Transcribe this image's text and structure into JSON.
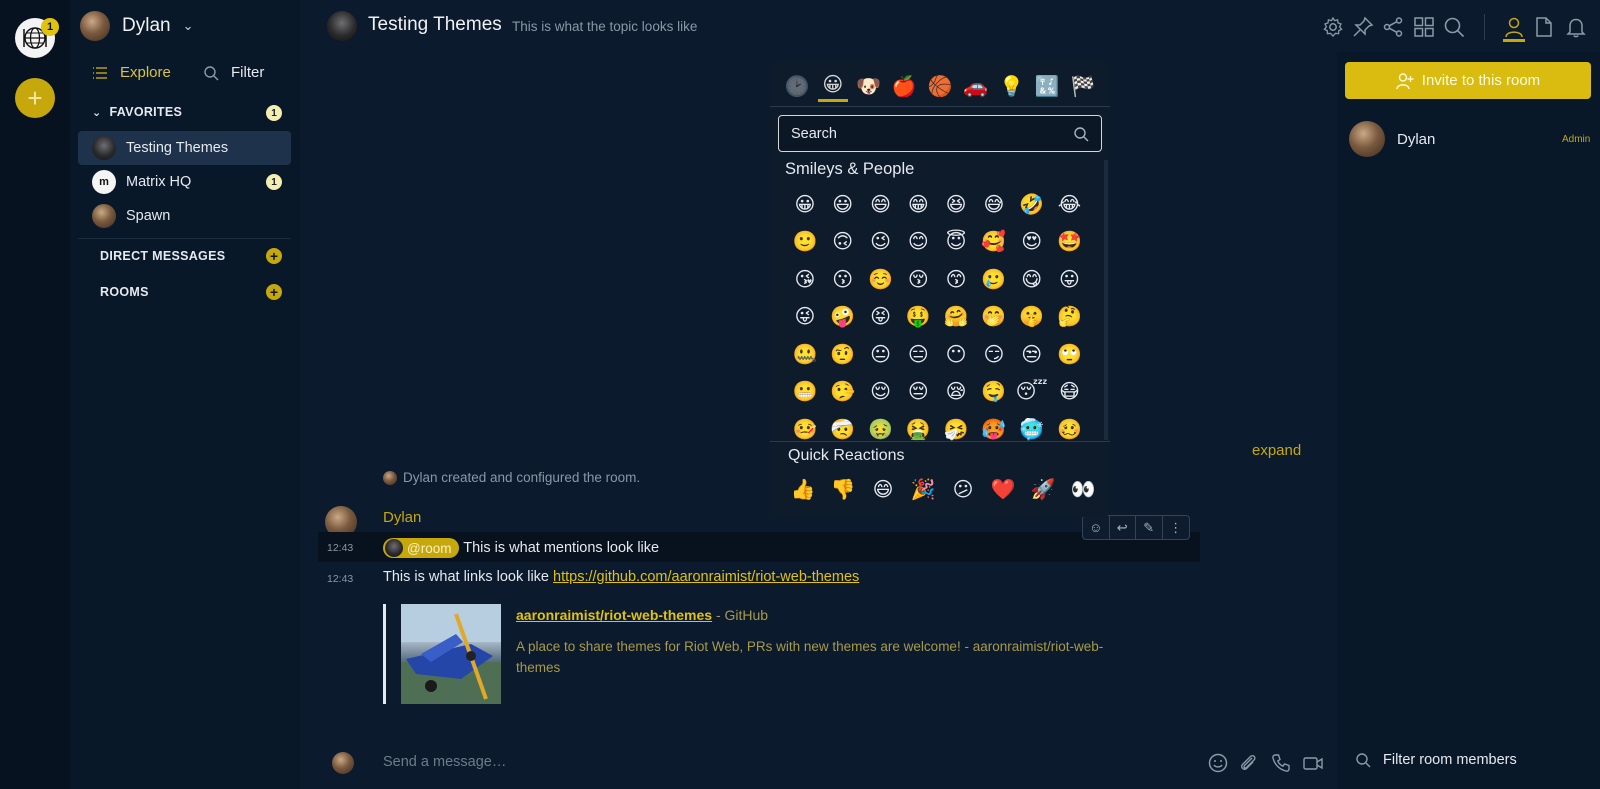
{
  "space_bar": {
    "home_badge": "1",
    "add_space_symbol": "+"
  },
  "room_list": {
    "user_name": "Dylan",
    "explore_label": "Explore",
    "filter_label": "Filter",
    "sections": {
      "favourites": {
        "label": "FAVORITES",
        "badge": "1"
      },
      "direct_messages": {
        "label": "DIRECT MESSAGES"
      },
      "rooms": {
        "label": "ROOMS"
      }
    },
    "rooms": [
      {
        "name": "Testing Themes",
        "badge": ""
      },
      {
        "name": "Matrix HQ",
        "badge": "1",
        "avatar_letter": "m"
      },
      {
        "name": "Spawn",
        "badge": ""
      }
    ]
  },
  "header": {
    "room_name": "Testing Themes",
    "topic": "This is what the topic looks like",
    "icons": [
      "settings-icon",
      "pin-icon",
      "share-icon",
      "apps-grid-icon",
      "search-icon",
      "people-icon",
      "files-icon",
      "notifications-icon"
    ]
  },
  "timeline": {
    "created_notice": "Dylan created and configured the room.",
    "expand_label": "expand",
    "sender": "Dylan",
    "messages": [
      {
        "time": "12:43",
        "mention": "@room",
        "text": "This is what mentions look like"
      },
      {
        "time": "12:43",
        "text": "This is what links look like",
        "link": "https://github.com/aaronraimist/riot-web-themes"
      }
    ],
    "preview": {
      "title": "aaronraimist/riot-web-themes",
      "site": "- GitHub",
      "description": "A place to share themes for Riot Web, PRs with new themes are welcome! - aaronraimist/riot-web-themes"
    }
  },
  "emoji_picker": {
    "categories": [
      "🕑",
      "😀",
      "🐶",
      "🍎",
      "🏀",
      "🚗",
      "💡",
      "🔣",
      "🏁"
    ],
    "search_placeholder": "Search",
    "category_title": "Smileys & People",
    "emojis": [
      "😀",
      "😃",
      "😄",
      "😁",
      "😆",
      "😅",
      "🤣",
      "😂",
      "🙂",
      "🙃",
      "😉",
      "😊",
      "😇",
      "🥰",
      "😍",
      "🤩",
      "😘",
      "😗",
      "☺️",
      "😚",
      "😙",
      "🥲",
      "😋",
      "😛",
      "😜",
      "🤪",
      "😝",
      "🤑",
      "🤗",
      "🤭",
      "🤫",
      "🤔",
      "🤐",
      "🤨",
      "😐",
      "😑",
      "😶",
      "😏",
      "😒",
      "🙄",
      "😬",
      "🤥",
      "😌",
      "😔",
      "😪",
      "🤤",
      "😴",
      "😷",
      "🤒",
      "🤕",
      "🤢",
      "🤮",
      "🤧",
      "🥵",
      "🥶",
      "🥴"
    ],
    "quick_reactions_title": "Quick Reactions",
    "quick_reactions": [
      "👍",
      "👎",
      "😄",
      "🎉",
      "😕",
      "❤️",
      "🚀",
      "👀"
    ]
  },
  "composer": {
    "placeholder": "Send a message…"
  },
  "right_panel": {
    "invite_label": "Invite to this room",
    "member_name": "Dylan",
    "member_role": "Admin",
    "filter_placeholder": "Filter room members"
  },
  "colors": {
    "accent": "#c6a80c",
    "background": "#0b1a2c",
    "panel": "#081829"
  }
}
